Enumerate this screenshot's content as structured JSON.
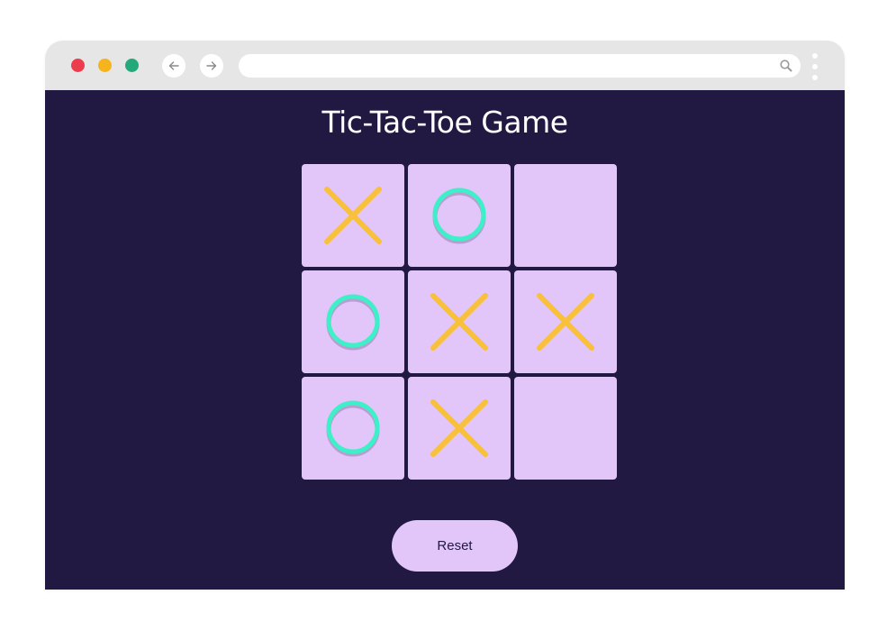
{
  "browser": {
    "address_value": "",
    "traffic_lights": [
      {
        "name": "close",
        "color": "#ec3d4f"
      },
      {
        "name": "minimize",
        "color": "#f5b41c"
      },
      {
        "name": "maximize",
        "color": "#26a97a"
      }
    ],
    "back_icon": "arrow-left-icon",
    "forward_icon": "arrow-right-icon",
    "search_icon": "search-icon",
    "menu_icon": "kebab-menu-icon"
  },
  "game": {
    "title": "Tic-Tac-Toe Game",
    "board": [
      [
        "X",
        "O",
        ""
      ],
      [
        "O",
        "X",
        "X"
      ],
      [
        "O",
        "X",
        ""
      ]
    ],
    "colors": {
      "background": "#211942",
      "cell": "#e2c6fa",
      "x_mark": "#f9c03b",
      "o_mark": "#3ef0c8"
    },
    "reset_label": "Reset"
  }
}
